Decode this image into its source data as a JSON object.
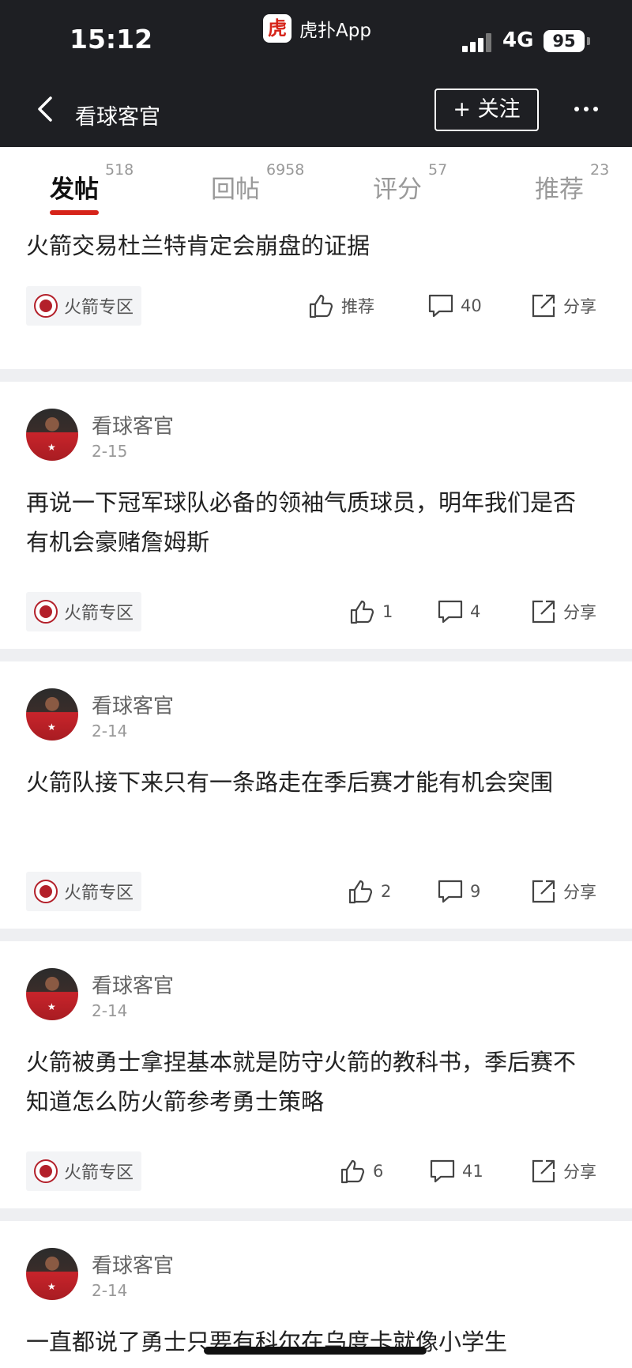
{
  "status_bar": {
    "time": "15:12",
    "app_name": "虎扑App",
    "app_logo_text": "虎",
    "network": "4G",
    "battery": "95"
  },
  "nav": {
    "title": "看球客官",
    "follow_label": "+ 关注"
  },
  "tabs": [
    {
      "label": "发帖",
      "count": "518",
      "active": true
    },
    {
      "label": "回帖",
      "count": "6958",
      "active": false
    },
    {
      "label": "评分",
      "count": "57",
      "active": false
    },
    {
      "label": "推荐",
      "count": "23",
      "active": false
    }
  ],
  "posts": [
    {
      "author": "",
      "date": "",
      "title": "火箭交易杜兰特肯定会崩盘的证据",
      "zone": "火箭专区",
      "likes": "推荐",
      "comments": "40",
      "share": "分享"
    },
    {
      "author": "看球客官",
      "date": "2-15",
      "title": "再说一下冠军球队必备的领袖气质球员，明年我们是否有机会豪赌詹姆斯",
      "zone": "火箭专区",
      "likes": "1",
      "comments": "4",
      "share": "分享"
    },
    {
      "author": "看球客官",
      "date": "2-14",
      "title": "火箭队接下来只有一条路走在季后赛才能有机会突围",
      "zone": "火箭专区",
      "likes": "2",
      "comments": "9",
      "share": "分享"
    },
    {
      "author": "看球客官",
      "date": "2-14",
      "title": "火箭被勇士拿捏基本就是防守火箭的教科书，季后赛不知道怎么防火箭参考勇士策略",
      "zone": "火箭专区",
      "likes": "6",
      "comments": "41",
      "share": "分享"
    },
    {
      "author": "看球客官",
      "date": "2-14",
      "title": "一直都说了勇士只要有科尔在乌度卡就像小学生",
      "zone": "",
      "likes": "",
      "comments": "",
      "share": ""
    }
  ],
  "colors": {
    "header_bg": "#1e1f23",
    "accent": "#d6241a",
    "divider": "#eeeff2"
  },
  "icons": [
    "back-arrow-icon",
    "more-icon",
    "thumb-up-icon",
    "comment-icon",
    "share-icon",
    "rockets-logo-icon"
  ]
}
